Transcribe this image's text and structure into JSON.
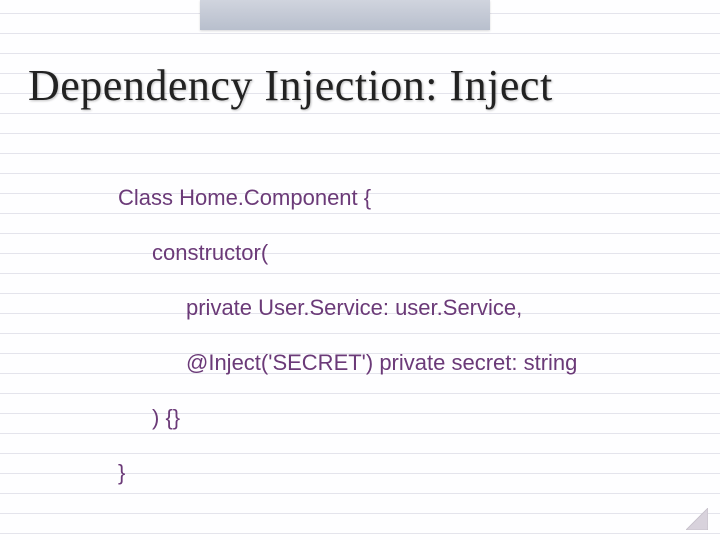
{
  "title": "Dependency Injection: Inject",
  "code": {
    "line1": "Class Home.Component {",
    "line2": "constructor(",
    "line3": "private User.Service: user.Service,",
    "line4": "@Inject('SECRET') private secret: string",
    "line5": ") {}",
    "line6": "}"
  }
}
